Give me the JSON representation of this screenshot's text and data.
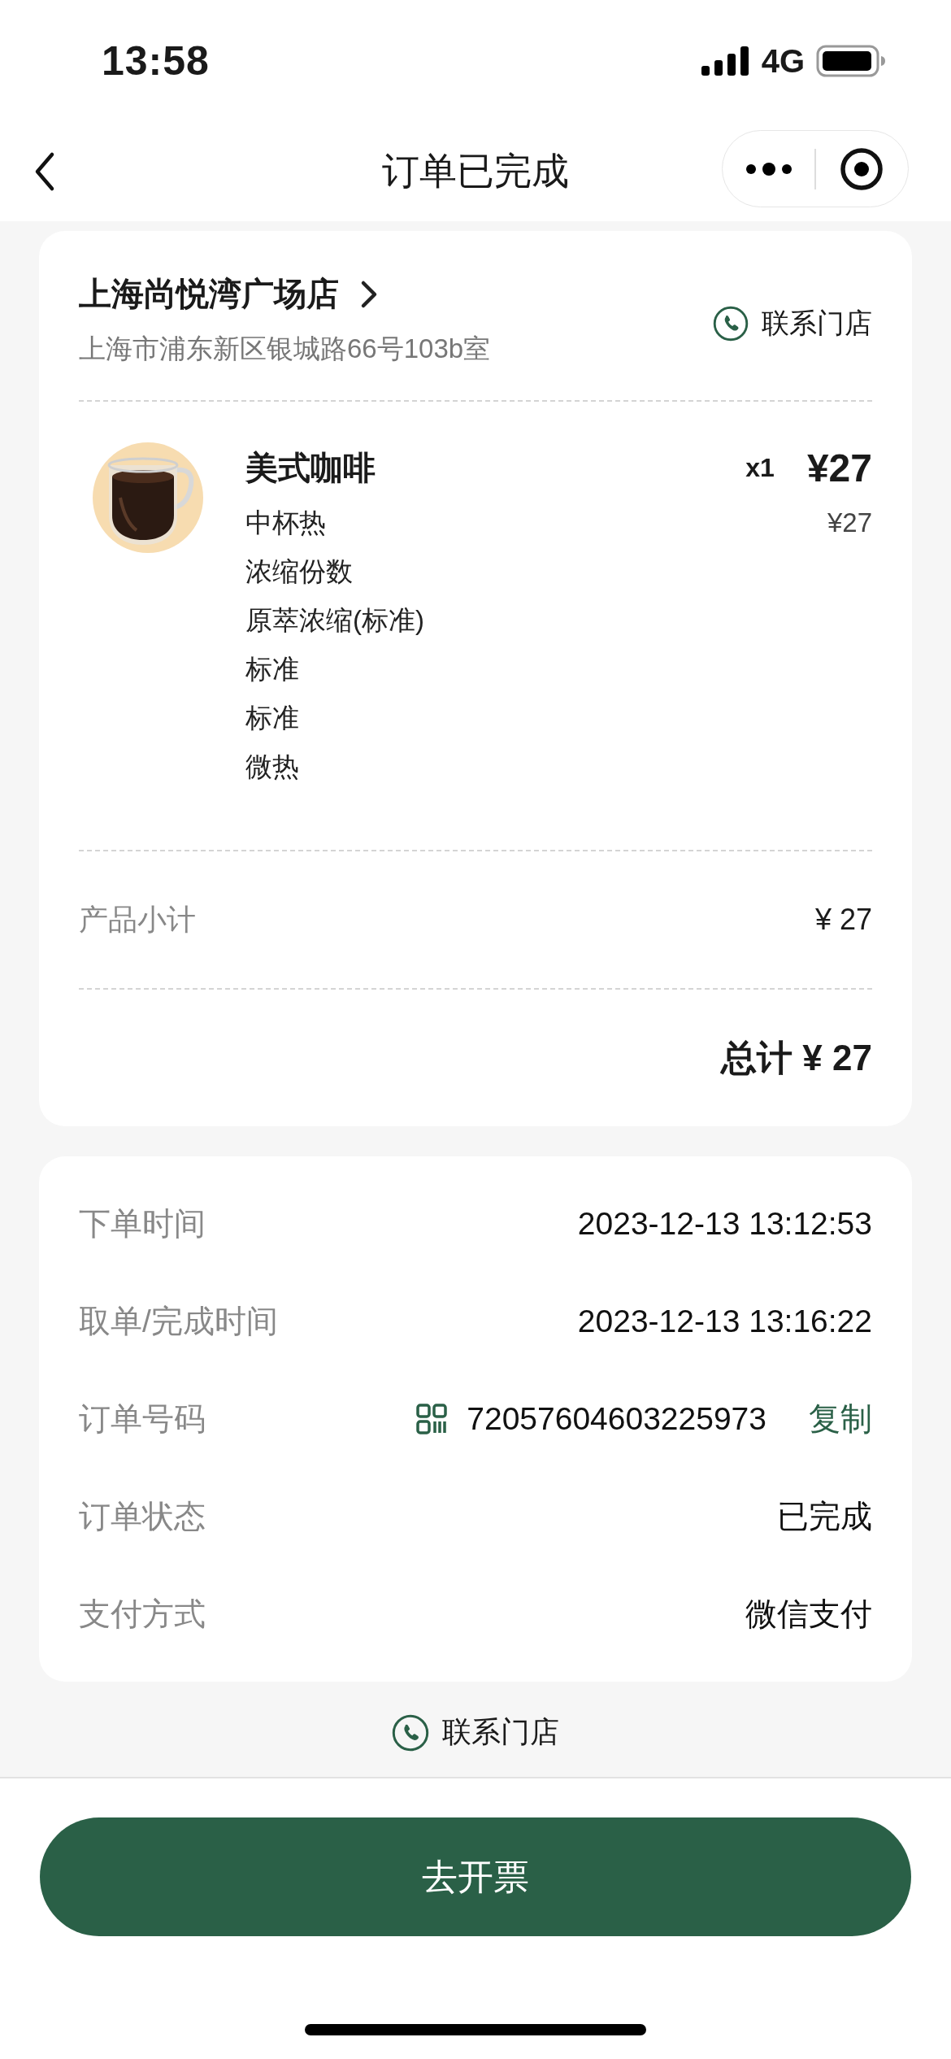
{
  "status_bar": {
    "time": "13:58",
    "network": "4G"
  },
  "nav": {
    "title": "订单已完成"
  },
  "store": {
    "name": "上海尚悦湾广场店",
    "address": "上海市浦东新区银城路66号103b室",
    "contact": "联系门店"
  },
  "items": [
    {
      "name": "美式咖啡",
      "quantity": "x1",
      "price": "¥27",
      "options": [
        {
          "label": "中杯热",
          "price": "¥27"
        },
        {
          "label": "浓缩份数"
        },
        {
          "label": "原萃浓缩(标准)"
        },
        {
          "label": "标准"
        },
        {
          "label": "标准"
        },
        {
          "label": "微热"
        }
      ]
    }
  ],
  "subtotal": {
    "label": "产品小计",
    "value": "¥ 27"
  },
  "total": {
    "label": "总计",
    "value": "¥ 27"
  },
  "details": [
    {
      "kind": "text",
      "label": "下单时间",
      "value": "2023-12-13 13:12:53"
    },
    {
      "kind": "text",
      "label": "取单/完成时间",
      "value": "2023-12-13 13:16:22"
    },
    {
      "kind": "order_number",
      "label": "订单号码",
      "value": "72057604603225973",
      "action": "复制"
    },
    {
      "kind": "text",
      "label": "订单状态",
      "value": "已完成"
    },
    {
      "kind": "text",
      "label": "支付方式",
      "value": "微信支付"
    }
  ],
  "contact_link": "联系门店",
  "invoice_button": "去开票"
}
